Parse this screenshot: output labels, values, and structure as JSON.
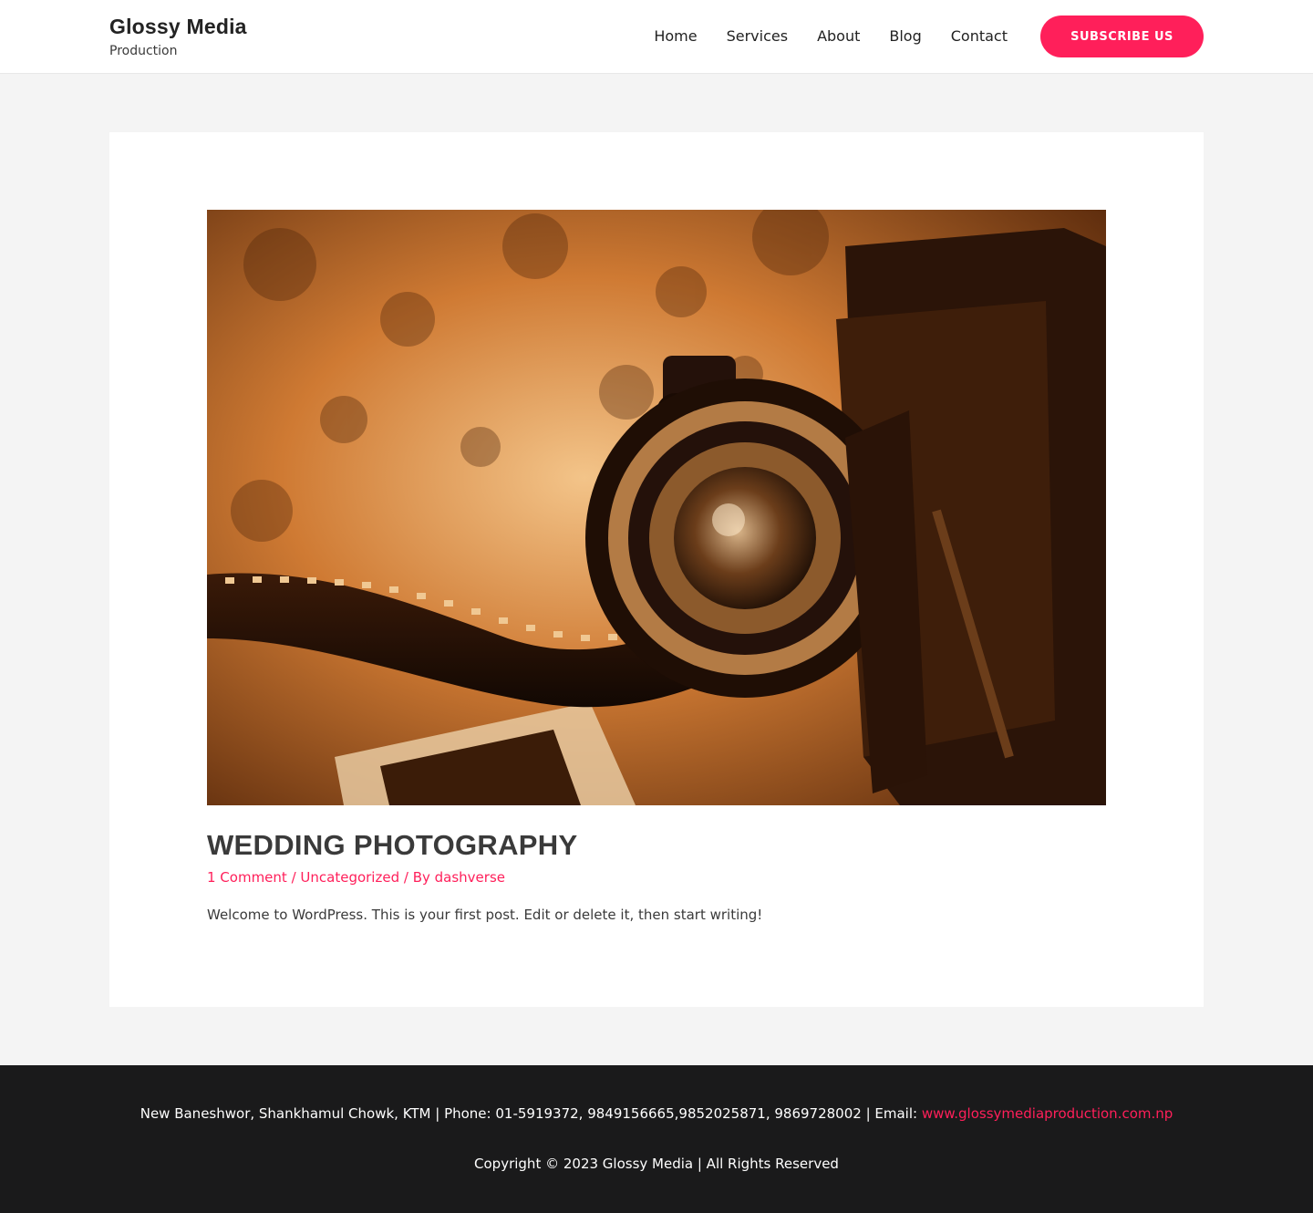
{
  "header": {
    "site_title": "Glossy Media",
    "tagline": "Production",
    "nav": [
      {
        "label": "Home"
      },
      {
        "label": "Services"
      },
      {
        "label": "About"
      },
      {
        "label": "Blog"
      },
      {
        "label": "Contact"
      }
    ],
    "cta_label": "SUBSCRIBE US"
  },
  "post": {
    "image_alt_subject": "vintage folding camera with film strip",
    "title": "WEDDING PHOTOGRAPHY",
    "meta": {
      "comments": "1 Comment",
      "sep1": " / ",
      "category": "Uncategorized",
      "by": " / By ",
      "author": "dashverse"
    },
    "excerpt": "Welcome to WordPress. This is your first post. Edit or delete it, then start writing!"
  },
  "footer": {
    "contact_text": "New Baneshwor, Shankhamul Chowk, KTM | Phone: 01-5919372, 9849156665,9852025871, 9869728002 | Email: ",
    "email_link": "www.glossymediaproduction.com.np",
    "copyright": "Copyright © 2023 Glossy Media | All Rights Reserved"
  },
  "colors": {
    "accent": "#ff1f5a",
    "footer_bg": "#1a1a1b",
    "page_bg": "#f4f4f4"
  }
}
